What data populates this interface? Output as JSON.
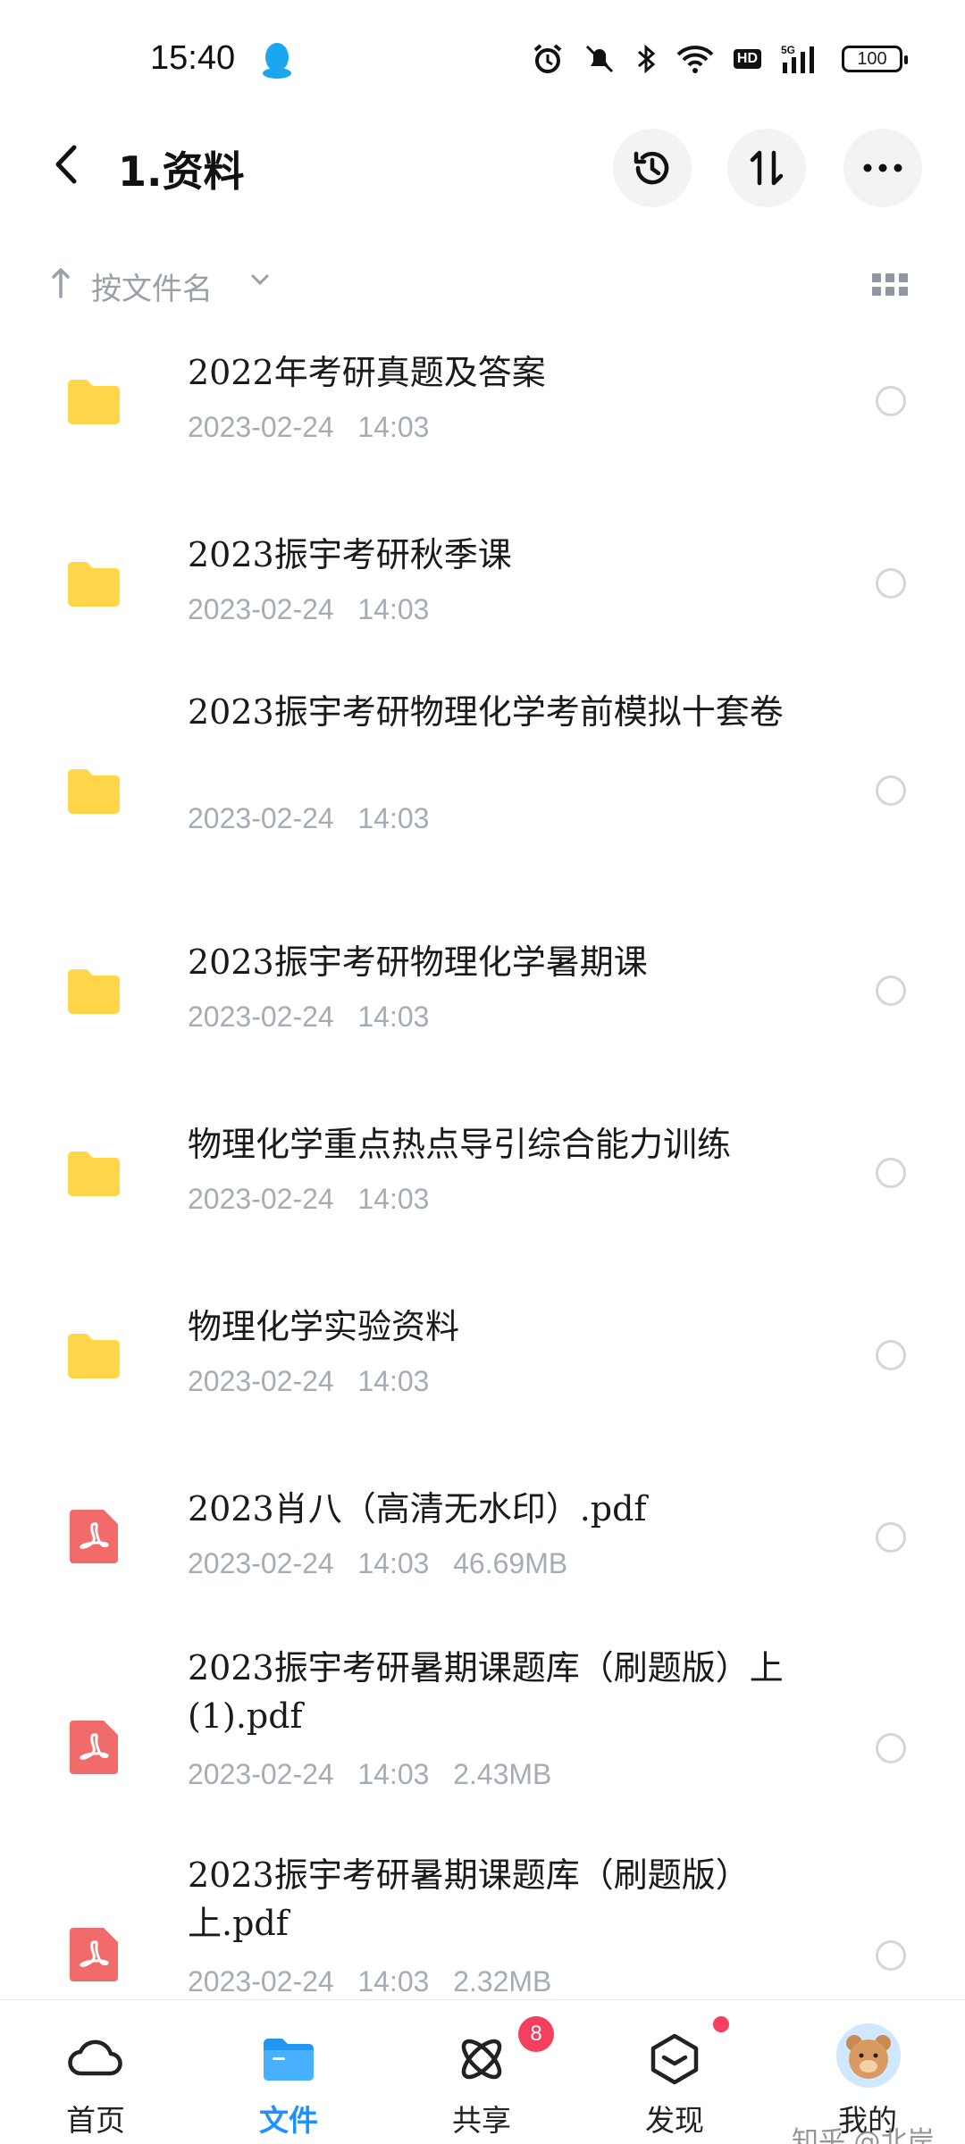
{
  "status_bar": {
    "time": "15:40",
    "battery": "100",
    "hd": "HD",
    "network": "5G"
  },
  "header": {
    "title": "1.资料"
  },
  "sort": {
    "label": "按文件名"
  },
  "files": [
    {
      "name": "2022年考研真题及答案",
      "date": "2023-02-24",
      "time": "14:03",
      "size": "",
      "type": "folder"
    },
    {
      "name": "2023振宇考研秋季课",
      "date": "2023-02-24",
      "time": "14:03",
      "size": "",
      "type": "folder"
    },
    {
      "name": "2023振宇考研物理化学考前模拟十套卷",
      "date": "2023-02-24",
      "time": "14:03",
      "size": "",
      "type": "folder"
    },
    {
      "name": "2023振宇考研物理化学暑期课",
      "date": "2023-02-24",
      "time": "14:03",
      "size": "",
      "type": "folder"
    },
    {
      "name": "物理化学重点热点导引综合能力训练",
      "date": "2023-02-24",
      "time": "14:03",
      "size": "",
      "type": "folder"
    },
    {
      "name": "物理化学实验资料",
      "date": "2023-02-24",
      "time": "14:03",
      "size": "",
      "type": "folder"
    },
    {
      "name": "2023肖八（高清无水印）.pdf",
      "date": "2023-02-24",
      "time": "14:03",
      "size": "46.69MB",
      "type": "pdf"
    },
    {
      "name": "2023振宇考研暑期课题库（刷题版）上(1).pdf",
      "date": "2023-02-24",
      "time": "14:03",
      "size": "2.43MB",
      "type": "pdf"
    },
    {
      "name": "2023振宇考研暑期课题库（刷题版）上.pdf",
      "date": "2023-02-24",
      "time": "14:03",
      "size": "2.32MB",
      "type": "pdf"
    }
  ],
  "bottom_nav": {
    "home": "首页",
    "files": "文件",
    "share": "共享",
    "share_badge": "8",
    "discover": "发现",
    "mine": "我的"
  },
  "watermark": "知乎 @北岸",
  "colors": {
    "accent": "#1e90ff",
    "folder": "#ffd54a",
    "pdf": "#f26b6b",
    "badge": "#f43f5e"
  }
}
